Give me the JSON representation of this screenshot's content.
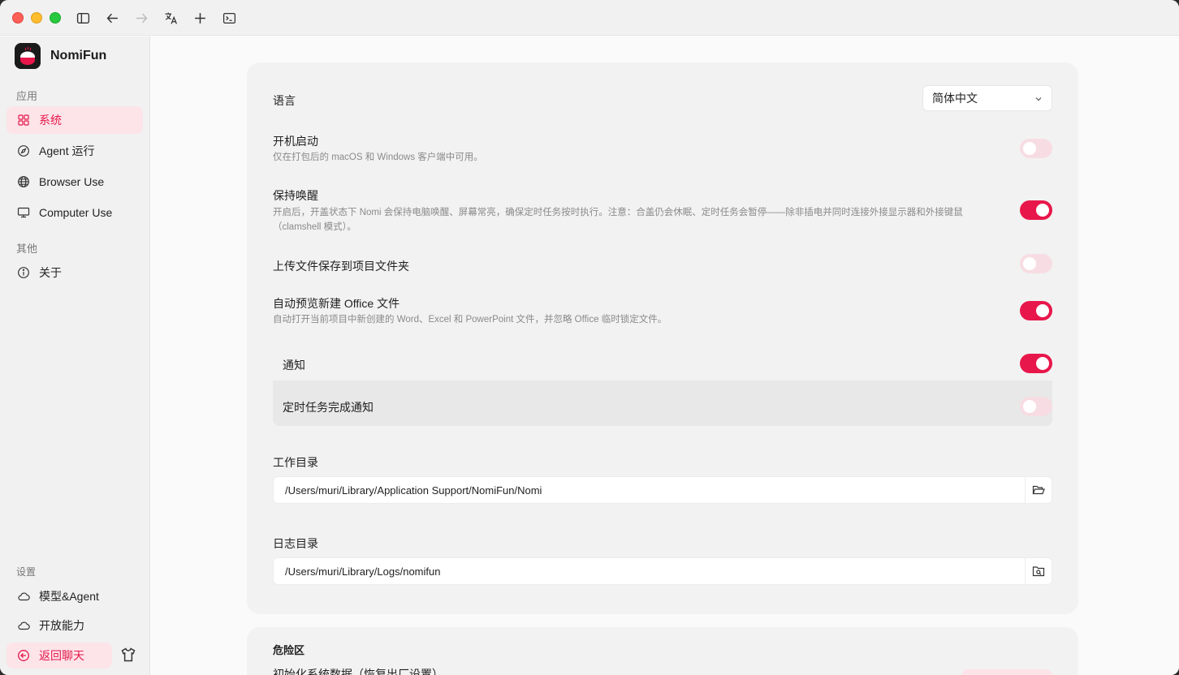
{
  "app": {
    "name": "NomiFun"
  },
  "sidebar": {
    "section_apps": "应用",
    "section_other": "其他",
    "section_settings": "设置",
    "items": [
      {
        "label": "系统",
        "icon": "grid-icon",
        "active": true
      },
      {
        "label": "Agent 运行",
        "icon": "compass-icon",
        "active": false
      },
      {
        "label": "Browser Use",
        "icon": "globe-icon",
        "active": false
      },
      {
        "label": "Computer Use",
        "icon": "monitor-icon",
        "active": false
      },
      {
        "label": "关于",
        "icon": "info-icon",
        "active": false
      }
    ],
    "settings_items": [
      {
        "label": "模型&Agent",
        "icon": "cloud-icon"
      },
      {
        "label": "开放能力",
        "icon": "cloud-icon"
      }
    ],
    "back_label": "返回聊天"
  },
  "settings": {
    "language": {
      "label": "语言",
      "value": "简体中文"
    },
    "autostart": {
      "label": "开机启动",
      "desc": "仅在打包后的 macOS 和 Windows 客户端中可用。",
      "enabled": false
    },
    "keep_awake": {
      "label": "保持唤醒",
      "desc": "开启后，开盖状态下 Nomi 会保持电脑唤醒、屏幕常亮，确保定时任务按时执行。注意：合盖仍会休眠、定时任务会暂停——除非插电并同时连接外接显示器和外接键鼠（clamshell 模式）。",
      "enabled": true
    },
    "save_uploads": {
      "label": "上传文件保存到项目文件夹",
      "enabled": false
    },
    "auto_preview": {
      "label": "自动预览新建 Office 文件",
      "desc": "自动打开当前项目中新创建的 Word、Excel 和 PowerPoint 文件，并忽略 Office 临时锁定文件。",
      "enabled": true
    },
    "notifications": {
      "label": "通知",
      "enabled": true
    },
    "task_done_notify": {
      "label": "定时任务完成通知",
      "enabled": false
    },
    "work_dir": {
      "label": "工作目录",
      "value": "/Users/muri/Library/Application Support/NomiFun/Nomi"
    },
    "log_dir": {
      "label": "日志目录",
      "value": "/Users/muri/Library/Logs/nomifun"
    }
  },
  "danger": {
    "title": "危险区",
    "reset_label": "初始化系统数据（恢复出厂设置）"
  },
  "colors": {
    "accent": "#e8174b",
    "accent_soft": "#fde4e9"
  }
}
